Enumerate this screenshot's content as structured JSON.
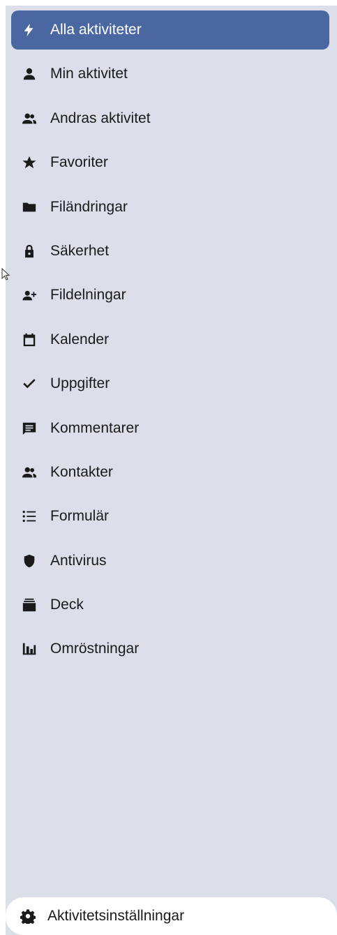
{
  "nav": {
    "items": [
      {
        "label": "Alla aktiviteter",
        "icon": "lightning-icon",
        "active": true
      },
      {
        "label": "Min aktivitet",
        "icon": "person-icon"
      },
      {
        "label": "Andras aktivitet",
        "icon": "group-icon"
      },
      {
        "label": "Favoriter",
        "icon": "star-icon"
      },
      {
        "label": "Filändringar",
        "icon": "folder-icon"
      },
      {
        "label": "Säkerhet",
        "icon": "lock-icon"
      },
      {
        "label": "Fildelningar",
        "icon": "person-add-icon"
      },
      {
        "label": "Kalender",
        "icon": "calendar-icon"
      },
      {
        "label": "Uppgifter",
        "icon": "checkmark-icon"
      },
      {
        "label": "Kommentarer",
        "icon": "comment-icon"
      },
      {
        "label": "Kontakter",
        "icon": "contacts-icon"
      },
      {
        "label": "Formulär",
        "icon": "list-icon"
      },
      {
        "label": "Antivirus",
        "icon": "shield-icon"
      },
      {
        "label": "Deck",
        "icon": "deck-icon"
      },
      {
        "label": "Omröstningar",
        "icon": "poll-icon"
      }
    ]
  },
  "settings": {
    "label": "Aktivitetsinställningar",
    "icon": "gear-icon"
  },
  "colors": {
    "sidebar_bg": "#dcdfea",
    "active_bg": "#4a67a1",
    "active_text": "#ffffff",
    "text": "#1a1a1a"
  }
}
